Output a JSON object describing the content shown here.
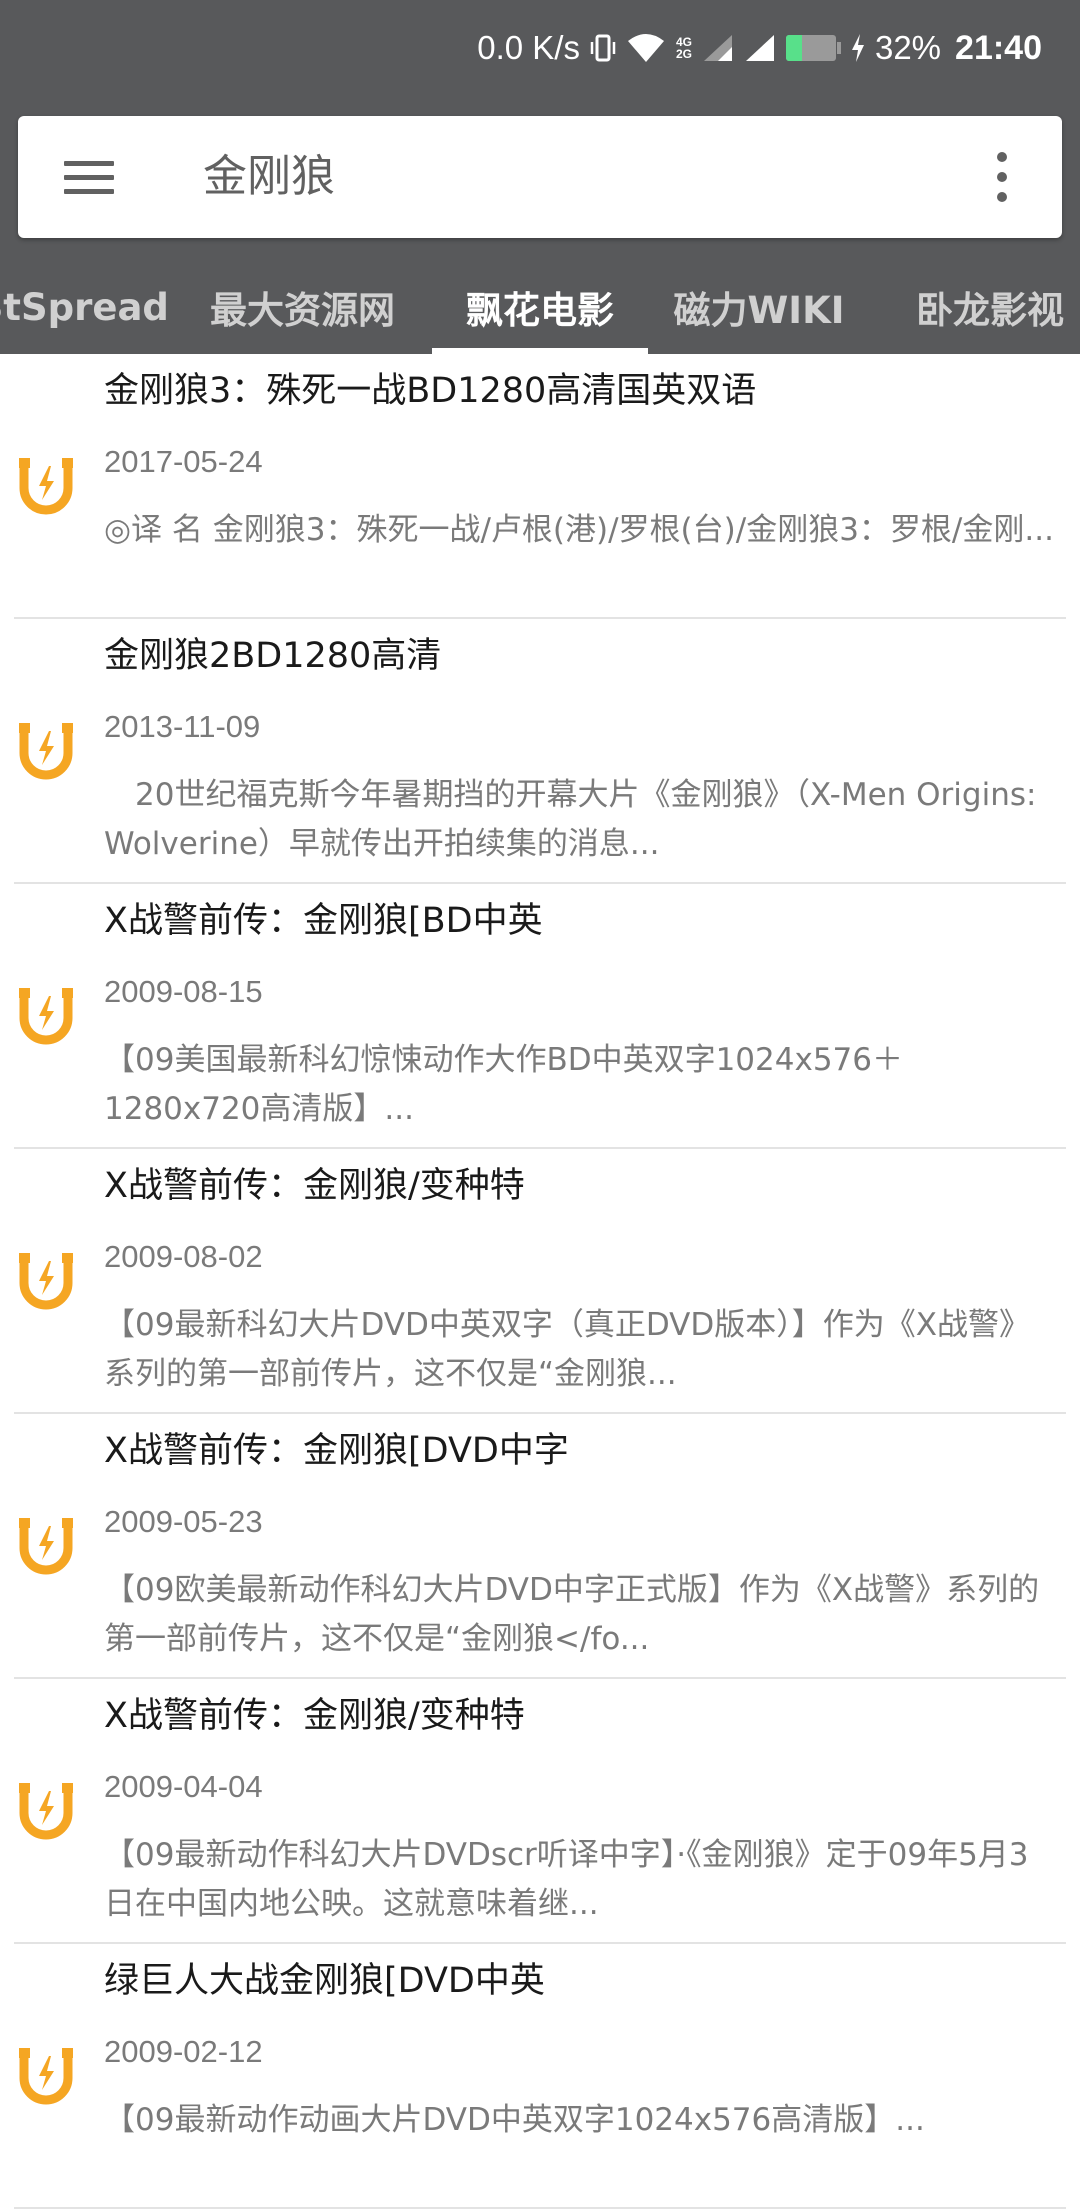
{
  "status_bar": {
    "net_speed": "0.0 K/s",
    "net_type_top": "4G",
    "net_type_bottom": "2G",
    "battery_percent": "32%",
    "battery_level": 0.32,
    "time": "21:40",
    "colors": {
      "battery_fill": "#58e08a"
    },
    "icons": [
      "vibrate-icon",
      "wifi-icon",
      "signal-icon",
      "signal-icon",
      "battery-icon",
      "charging-icon"
    ]
  },
  "search": {
    "query": "金刚狼",
    "menu_icon": "hamburger-menu-icon",
    "more_icon": "more-vertical-icon"
  },
  "tabs": [
    {
      "label": "BtSpread"
    },
    {
      "label": "最大资源网"
    },
    {
      "label": "飘花电影",
      "active": true
    },
    {
      "label": "磁力WIKI"
    },
    {
      "label": "卧龙影视"
    }
  ],
  "results": [
    {
      "title": "金刚狼3：殊死一战BD1280高清国英双语",
      "date": "2017-05-24",
      "desc": "◎译 名 金刚狼3：殊死一战/卢根(港)/罗根(台)/金刚狼3：罗根/金刚..."
    },
    {
      "title": "金刚狼2BD1280高清",
      "date": "2013-11-09",
      "desc": "　20世纪福克斯今年暑期挡的开幕大片《金刚狼》（X-Men Origins: Wolverine）早就传出开拍续集的消息..."
    },
    {
      "title": "X战警前传：金刚狼[BD中英",
      "date": "2009-08-15",
      "desc": "【09美国最新科幻惊悚动作大作BD中英双字1024x576＋1280x720高清版】..."
    },
    {
      "title": "X战警前传：金刚狼/变种特",
      "date": "2009-08-02",
      "desc": "【09最新科幻大片DVD中英双字（真正DVD版本）】作为《X战警》系列的第一部前传片，这不仅是“金刚狼..."
    },
    {
      "title": "X战警前传：金刚狼[DVD中字",
      "date": "2009-05-23",
      "desc": "【09欧美最新动作科幻大片DVD中字正式版】作为《X战警》系列的第一部前传片，这不仅是“金刚狼</fo..."
    },
    {
      "title": "X战警前传：金刚狼/变种特",
      "date": "2009-04-04",
      "desc": "【09最新动作科幻大片DVDscr听译中字】·《金刚狼》定于09年5月3日在中国内地公映。这就意味着继..."
    },
    {
      "title": "绿巨人大战金刚狼[DVD中英",
      "date": "2009-02-12",
      "desc": "【09最新动作动画大片DVD中英双字1024x576高清版】..."
    }
  ],
  "result_icon": "magnet-icon",
  "colors": {
    "header_bg": "#58595b",
    "magnet_orange": "#f5a623",
    "title_text": "#1a1a1a",
    "secondary_text": "#7a7a7a"
  }
}
